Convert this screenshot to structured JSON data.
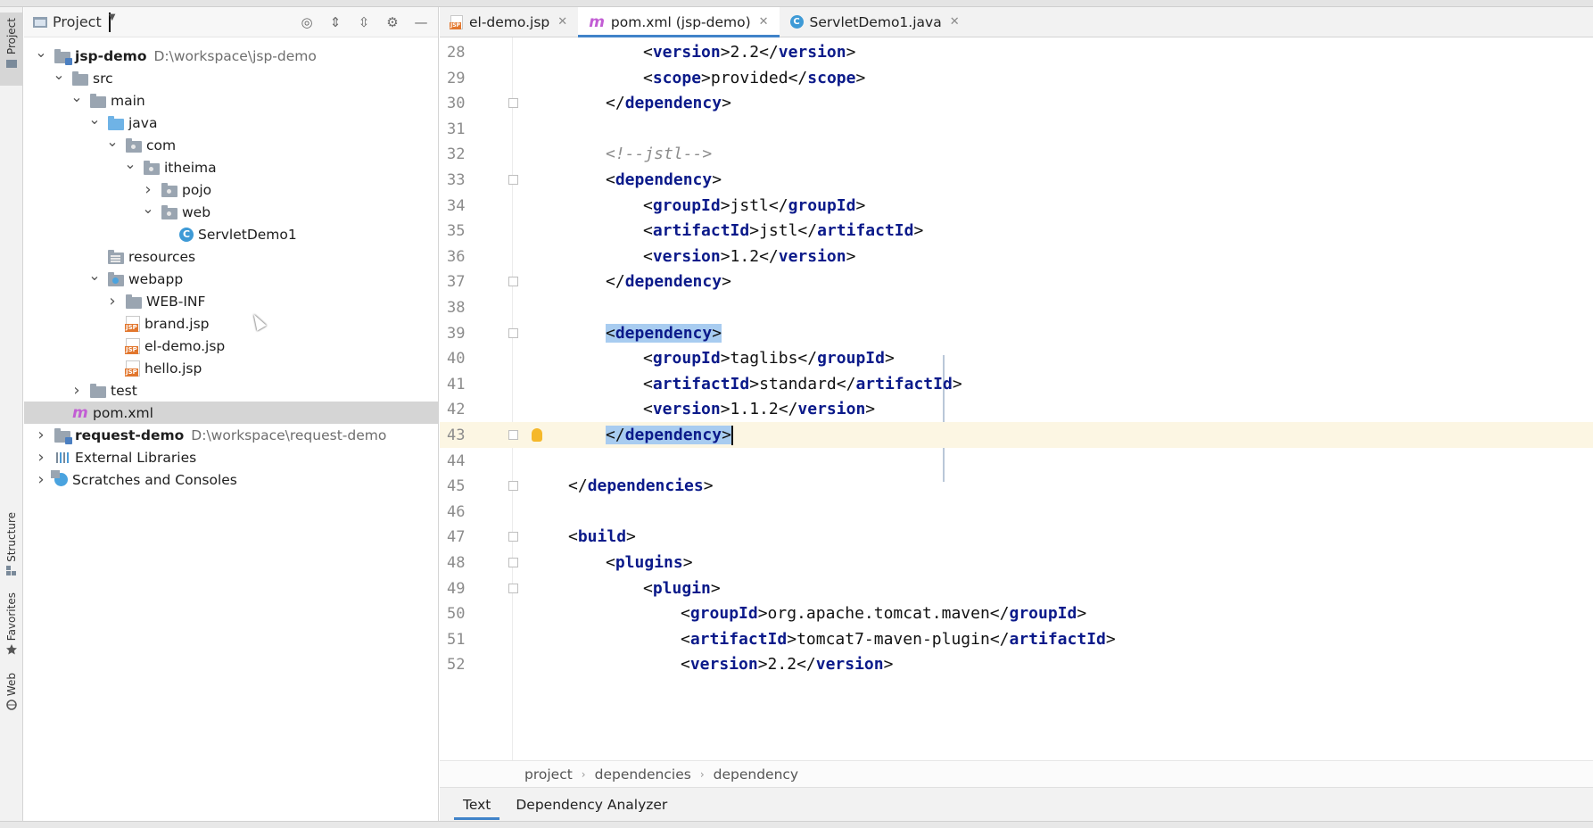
{
  "project_panel": {
    "title": "Project",
    "tree": [
      {
        "label": "jsp-demo",
        "path": "D:\\workspace\\jsp-demo",
        "bold": true,
        "depth": 0,
        "chevron": "open",
        "icon": "module-folder"
      },
      {
        "label": "src",
        "depth": 1,
        "chevron": "open",
        "icon": "folder"
      },
      {
        "label": "main",
        "depth": 2,
        "chevron": "open",
        "icon": "folder"
      },
      {
        "label": "java",
        "depth": 3,
        "chevron": "open",
        "icon": "source-folder"
      },
      {
        "label": "com",
        "depth": 4,
        "chevron": "open",
        "icon": "package"
      },
      {
        "label": "itheima",
        "depth": 5,
        "chevron": "open",
        "icon": "package"
      },
      {
        "label": "pojo",
        "depth": 6,
        "chevron": "closed",
        "icon": "package"
      },
      {
        "label": "web",
        "depth": 6,
        "chevron": "open",
        "icon": "package"
      },
      {
        "label": "ServletDemo1",
        "depth": 7,
        "chevron": "none",
        "icon": "class"
      },
      {
        "label": "resources",
        "depth": 3,
        "chevron": "none",
        "icon": "resources-folder"
      },
      {
        "label": "webapp",
        "depth": 3,
        "chevron": "open",
        "icon": "web-folder"
      },
      {
        "label": "WEB-INF",
        "depth": 4,
        "chevron": "closed",
        "icon": "folder"
      },
      {
        "label": "brand.jsp",
        "depth": 4,
        "chevron": "none",
        "icon": "jsp"
      },
      {
        "label": "el-demo.jsp",
        "depth": 4,
        "chevron": "none",
        "icon": "jsp"
      },
      {
        "label": "hello.jsp",
        "depth": 4,
        "chevron": "none",
        "icon": "jsp"
      },
      {
        "label": "test",
        "depth": 2,
        "chevron": "closed",
        "icon": "folder"
      },
      {
        "label": "pom.xml",
        "depth": 1,
        "chevron": "none",
        "icon": "maven",
        "selected": true
      },
      {
        "label": "request-demo",
        "path": "D:\\workspace\\request-demo",
        "bold": true,
        "depth": 0,
        "chevron": "closed",
        "icon": "module-folder"
      },
      {
        "label": "External Libraries",
        "depth": 0,
        "chevron": "closed",
        "icon": "libraries"
      },
      {
        "label": "Scratches and Consoles",
        "depth": 0,
        "chevron": "closed",
        "icon": "scratches"
      }
    ]
  },
  "tool_strip": {
    "project": "Project",
    "structure": "Structure",
    "favorites": "Favorites",
    "web": "Web"
  },
  "editor_tabs": [
    {
      "label": "el-demo.jsp",
      "icon": "jsp",
      "active": false
    },
    {
      "label": "pom.xml (jsp-demo)",
      "icon": "maven",
      "active": true
    },
    {
      "label": "ServletDemo1.java",
      "icon": "class",
      "active": false
    }
  ],
  "code_lines": [
    {
      "n": "28",
      "indent": 2,
      "parts": [
        [
          "br",
          "<"
        ],
        [
          "tag",
          "version"
        ],
        [
          "br",
          ">"
        ],
        [
          "txt",
          "2.2"
        ],
        [
          "br",
          "</"
        ],
        [
          "tag",
          "version"
        ],
        [
          "br",
          ">"
        ]
      ]
    },
    {
      "n": "29",
      "indent": 2,
      "parts": [
        [
          "br",
          "<"
        ],
        [
          "tag",
          "scope"
        ],
        [
          "br",
          ">"
        ],
        [
          "txt",
          "provided"
        ],
        [
          "br",
          "</"
        ],
        [
          "tag",
          "scope"
        ],
        [
          "br",
          ">"
        ]
      ]
    },
    {
      "n": "30",
      "indent": 1,
      "fold": true,
      "parts": [
        [
          "br",
          "</"
        ],
        [
          "tag",
          "dependency"
        ],
        [
          "br",
          ">"
        ]
      ]
    },
    {
      "n": "31",
      "indent": 0,
      "parts": []
    },
    {
      "n": "32",
      "indent": 1,
      "parts": [
        [
          "cmt",
          "<!--jstl-->"
        ]
      ]
    },
    {
      "n": "33",
      "indent": 1,
      "fold": true,
      "parts": [
        [
          "br",
          "<"
        ],
        [
          "tag",
          "dependency"
        ],
        [
          "br",
          ">"
        ]
      ]
    },
    {
      "n": "34",
      "indent": 2,
      "parts": [
        [
          "br",
          "<"
        ],
        [
          "tag",
          "groupId"
        ],
        [
          "br",
          ">"
        ],
        [
          "txt",
          "jstl"
        ],
        [
          "br",
          "</"
        ],
        [
          "tag",
          "groupId"
        ],
        [
          "br",
          ">"
        ]
      ]
    },
    {
      "n": "35",
      "indent": 2,
      "parts": [
        [
          "br",
          "<"
        ],
        [
          "tag",
          "artifactId"
        ],
        [
          "br",
          ">"
        ],
        [
          "txt",
          "jstl"
        ],
        [
          "br",
          "</"
        ],
        [
          "tag",
          "artifactId"
        ],
        [
          "br",
          ">"
        ]
      ]
    },
    {
      "n": "36",
      "indent": 2,
      "parts": [
        [
          "br",
          "<"
        ],
        [
          "tag",
          "version"
        ],
        [
          "br",
          ">"
        ],
        [
          "txt",
          "1.2"
        ],
        [
          "br",
          "</"
        ],
        [
          "tag",
          "version"
        ],
        [
          "br",
          ">"
        ]
      ]
    },
    {
      "n": "37",
      "indent": 1,
      "fold": true,
      "parts": [
        [
          "br",
          "</"
        ],
        [
          "tag",
          "dependency"
        ],
        [
          "br",
          ">"
        ]
      ]
    },
    {
      "n": "38",
      "indent": 0,
      "parts": []
    },
    {
      "n": "39",
      "indent": 1,
      "fold": true,
      "selected": true,
      "parts": [
        [
          "br",
          "<"
        ],
        [
          "tag",
          "dependency"
        ],
        [
          "br",
          ">"
        ]
      ]
    },
    {
      "n": "40",
      "indent": 2,
      "parts": [
        [
          "br",
          "<"
        ],
        [
          "tag",
          "groupId"
        ],
        [
          "br",
          ">"
        ],
        [
          "txt",
          "taglibs"
        ],
        [
          "br",
          "</"
        ],
        [
          "tag",
          "groupId"
        ],
        [
          "br",
          ">"
        ]
      ]
    },
    {
      "n": "41",
      "indent": 2,
      "parts": [
        [
          "br",
          "<"
        ],
        [
          "tag",
          "artifactId"
        ],
        [
          "br",
          ">"
        ],
        [
          "txt",
          "standard"
        ],
        [
          "br",
          "</"
        ],
        [
          "tag",
          "artifactId"
        ],
        [
          "br",
          ">"
        ]
      ]
    },
    {
      "n": "42",
      "indent": 2,
      "parts": [
        [
          "br",
          "<"
        ],
        [
          "tag",
          "version"
        ],
        [
          "br",
          ">"
        ],
        [
          "txt",
          "1.1.2"
        ],
        [
          "br",
          "</"
        ],
        [
          "tag",
          "version"
        ],
        [
          "br",
          ">"
        ]
      ]
    },
    {
      "n": "43",
      "indent": 1,
      "fold": true,
      "selected": true,
      "current": true,
      "bulb": true,
      "caret": true,
      "parts": [
        [
          "br",
          "</"
        ],
        [
          "tag",
          "dependency"
        ],
        [
          "br",
          ">"
        ]
      ]
    },
    {
      "n": "44",
      "indent": 0,
      "parts": []
    },
    {
      "n": "45",
      "indent": 0,
      "fold": true,
      "parts": [
        [
          "br",
          "</"
        ],
        [
          "tag",
          "dependencies"
        ],
        [
          "br",
          ">"
        ]
      ]
    },
    {
      "n": "46",
      "indent": 0,
      "parts": []
    },
    {
      "n": "47",
      "indent": 0,
      "fold": true,
      "parts": [
        [
          "br",
          "<"
        ],
        [
          "tag",
          "build"
        ],
        [
          "br",
          ">"
        ]
      ]
    },
    {
      "n": "48",
      "indent": 1,
      "fold": true,
      "parts": [
        [
          "br",
          "<"
        ],
        [
          "tag",
          "plugins"
        ],
        [
          "br",
          ">"
        ]
      ]
    },
    {
      "n": "49",
      "indent": 2,
      "fold": true,
      "parts": [
        [
          "br",
          "<"
        ],
        [
          "tag",
          "plugin"
        ],
        [
          "br",
          ">"
        ]
      ]
    },
    {
      "n": "50",
      "indent": 3,
      "parts": [
        [
          "br",
          "<"
        ],
        [
          "tag",
          "groupId"
        ],
        [
          "br",
          ">"
        ],
        [
          "txt",
          "org.apache.tomcat.maven"
        ],
        [
          "br",
          "</"
        ],
        [
          "tag",
          "groupId"
        ],
        [
          "br",
          ">"
        ]
      ]
    },
    {
      "n": "51",
      "indent": 3,
      "parts": [
        [
          "br",
          "<"
        ],
        [
          "tag",
          "artifactId"
        ],
        [
          "br",
          ">"
        ],
        [
          "txt",
          "tomcat7-maven-plugin"
        ],
        [
          "br",
          "</"
        ],
        [
          "tag",
          "artifactId"
        ],
        [
          "br",
          ">"
        ]
      ]
    },
    {
      "n": "52",
      "indent": 3,
      "parts": [
        [
          "br",
          "<"
        ],
        [
          "tag",
          "version"
        ],
        [
          "br",
          ">"
        ],
        [
          "txt",
          "2.2"
        ],
        [
          "br",
          "</"
        ],
        [
          "tag",
          "version"
        ],
        [
          "br",
          ">"
        ]
      ]
    }
  ],
  "breadcrumbs": [
    "project",
    "dependencies",
    "dependency"
  ],
  "bottom_tabs": [
    {
      "label": "Text",
      "active": true
    },
    {
      "label": "Dependency Analyzer",
      "active": false
    }
  ],
  "colors": {
    "accent": "#4083c9",
    "tag": "#0b1a8a",
    "selection": "#a8ccf0",
    "current_line": "#fcf6e3",
    "maven_icon": "#c25dd4"
  }
}
